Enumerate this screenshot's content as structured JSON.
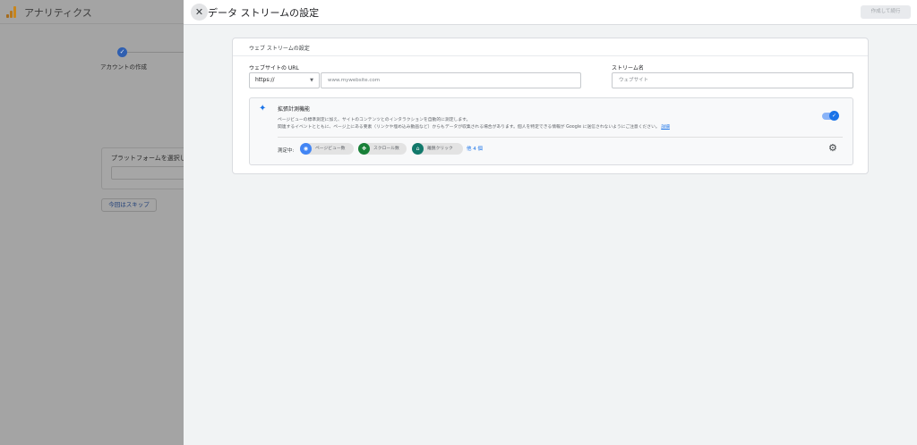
{
  "background": {
    "app_title": "アナリティクス",
    "step_label": "アカウントの作成",
    "platform_card_title": "プラットフォームを選択し",
    "skip_button": "今回はスキップ"
  },
  "dialog": {
    "title": "データ ストリームの設定",
    "create_button": "作成して続行",
    "card_title": "ウェブ ストリームの設定",
    "url_label": "ウェブサイトの URL",
    "protocol_value": "https://",
    "url_placeholder": "www.mywebsite.com",
    "stream_name_label": "ストリーム名",
    "stream_name_placeholder": "ウェブサイト",
    "enhanced": {
      "title": "拡張計測機能",
      "desc_line1": "ページビューの標準測定に加え、サイトのコンテンツとのインタラクションを自動的に測定します。",
      "desc_line2": "関連するイベントとともに、ページ上にある要素（リンクや埋め込み動画など）からもデータが収集される場合があります。個人を特定できる情報が Google に送信されないようにご注意ください。",
      "desc_link": "詳細",
      "toggle_on": true,
      "measuring_label": "測定中:",
      "chips": [
        {
          "label": "ページビュー数",
          "icon": "eye-icon",
          "color": "#4285f4"
        },
        {
          "label": "スクロール数",
          "icon": "scroll-icon",
          "color": "#188038"
        },
        {
          "label": "離脱クリック",
          "icon": "click-icon",
          "color": "#12796b"
        }
      ],
      "more_link": "他 4 個"
    }
  }
}
